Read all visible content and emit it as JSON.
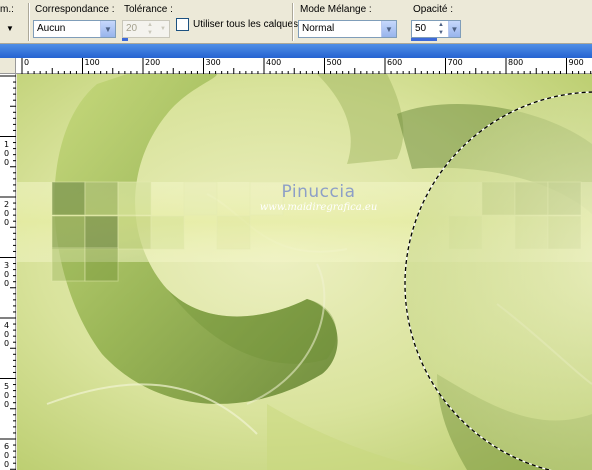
{
  "toolbar": {
    "partial_label": "m.:",
    "correspondance": {
      "label": "Correspondance :",
      "value": "Aucun"
    },
    "tolerance": {
      "label": "Tolérance :",
      "value": "20"
    },
    "all_layers": {
      "label": "Utiliser tous les calques",
      "checked": false
    },
    "blend_mode": {
      "label": "Mode Mélange :",
      "value": "Normal"
    },
    "opacity": {
      "label": "Opacité :",
      "value": "50"
    }
  },
  "ruler_top": [
    "0",
    "100",
    "200",
    "300",
    "400",
    "500",
    "600",
    "700",
    "800",
    "900"
  ],
  "ruler_left": [
    "1\n0\n0",
    "2\n0\n0",
    "3\n0\n0",
    "4\n0\n0",
    "5\n0\n0",
    "6\n0\n0"
  ],
  "canvas": {
    "watermark_title": "Pinuccia",
    "watermark_url": "www.maidiregrafica.eu",
    "selection": "circle-marquee"
  },
  "colors": {
    "toolbar_bg": "#ece9d8",
    "canvas_green_light": "#e4eab0",
    "canvas_green_dark": "#6e8f35",
    "title_blue": "#2563d1"
  }
}
